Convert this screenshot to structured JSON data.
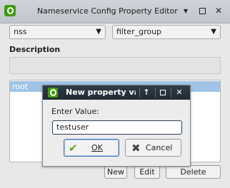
{
  "window": {
    "title": "Nameservice Config Property Editor",
    "logo": "Q"
  },
  "controls": {
    "left_combo": "nss",
    "right_combo": "filter_group"
  },
  "description": {
    "heading": "Description"
  },
  "list": {
    "items": [
      "root"
    ]
  },
  "buttons": {
    "new": "New",
    "edit": "Edit",
    "delete": "Delete"
  },
  "dialog": {
    "title": "New property val",
    "logo": "Q",
    "prompt": "Enter Value:",
    "value": "testuser",
    "ok": "OK",
    "cancel": "Cancel"
  },
  "colors": {
    "accent_green": "#3f9a10",
    "selection": "#9fc4e6",
    "dialog_titlebar": "#26323c"
  }
}
